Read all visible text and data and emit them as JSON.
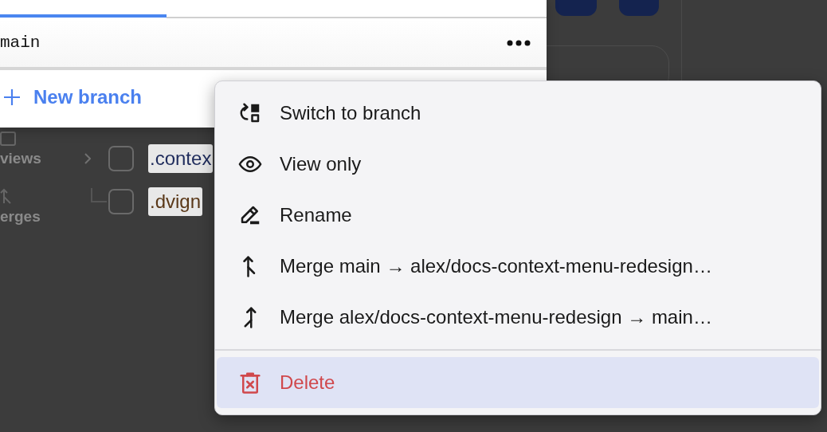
{
  "branch_panel": {
    "branches": [
      {
        "name": "main"
      }
    ],
    "new_branch": {
      "label": "New branch"
    }
  },
  "sidebar": {
    "items": [
      {
        "label": "views"
      },
      {
        "label": "erges"
      }
    ]
  },
  "tree": {
    "rows": [
      {
        "name": ".contex",
        "color": "#1f2c5c",
        "expandable": true,
        "checked": false
      },
      {
        "name": ".dvign",
        "color": "#5a3818",
        "expandable": false,
        "checked": false
      }
    ]
  },
  "context_menu": {
    "items": [
      {
        "kind": "switch",
        "label": "Switch to branch",
        "selected": false,
        "danger": false,
        "divider_before": false
      },
      {
        "kind": "view",
        "label": "View only",
        "selected": false,
        "danger": false,
        "divider_before": false
      },
      {
        "kind": "rename",
        "label": "Rename",
        "selected": false,
        "danger": false,
        "divider_before": false
      },
      {
        "kind": "merge-in",
        "label": "Merge main → alex/docs-context-menu-redesign…",
        "selected": false,
        "danger": false,
        "divider_before": false
      },
      {
        "kind": "merge-out",
        "label": "Merge alex/docs-context-menu-redesign → main…",
        "selected": false,
        "danger": false,
        "divider_before": false
      },
      {
        "kind": "delete",
        "label": "Delete",
        "selected": true,
        "danger": true,
        "divider_before": true
      }
    ]
  }
}
